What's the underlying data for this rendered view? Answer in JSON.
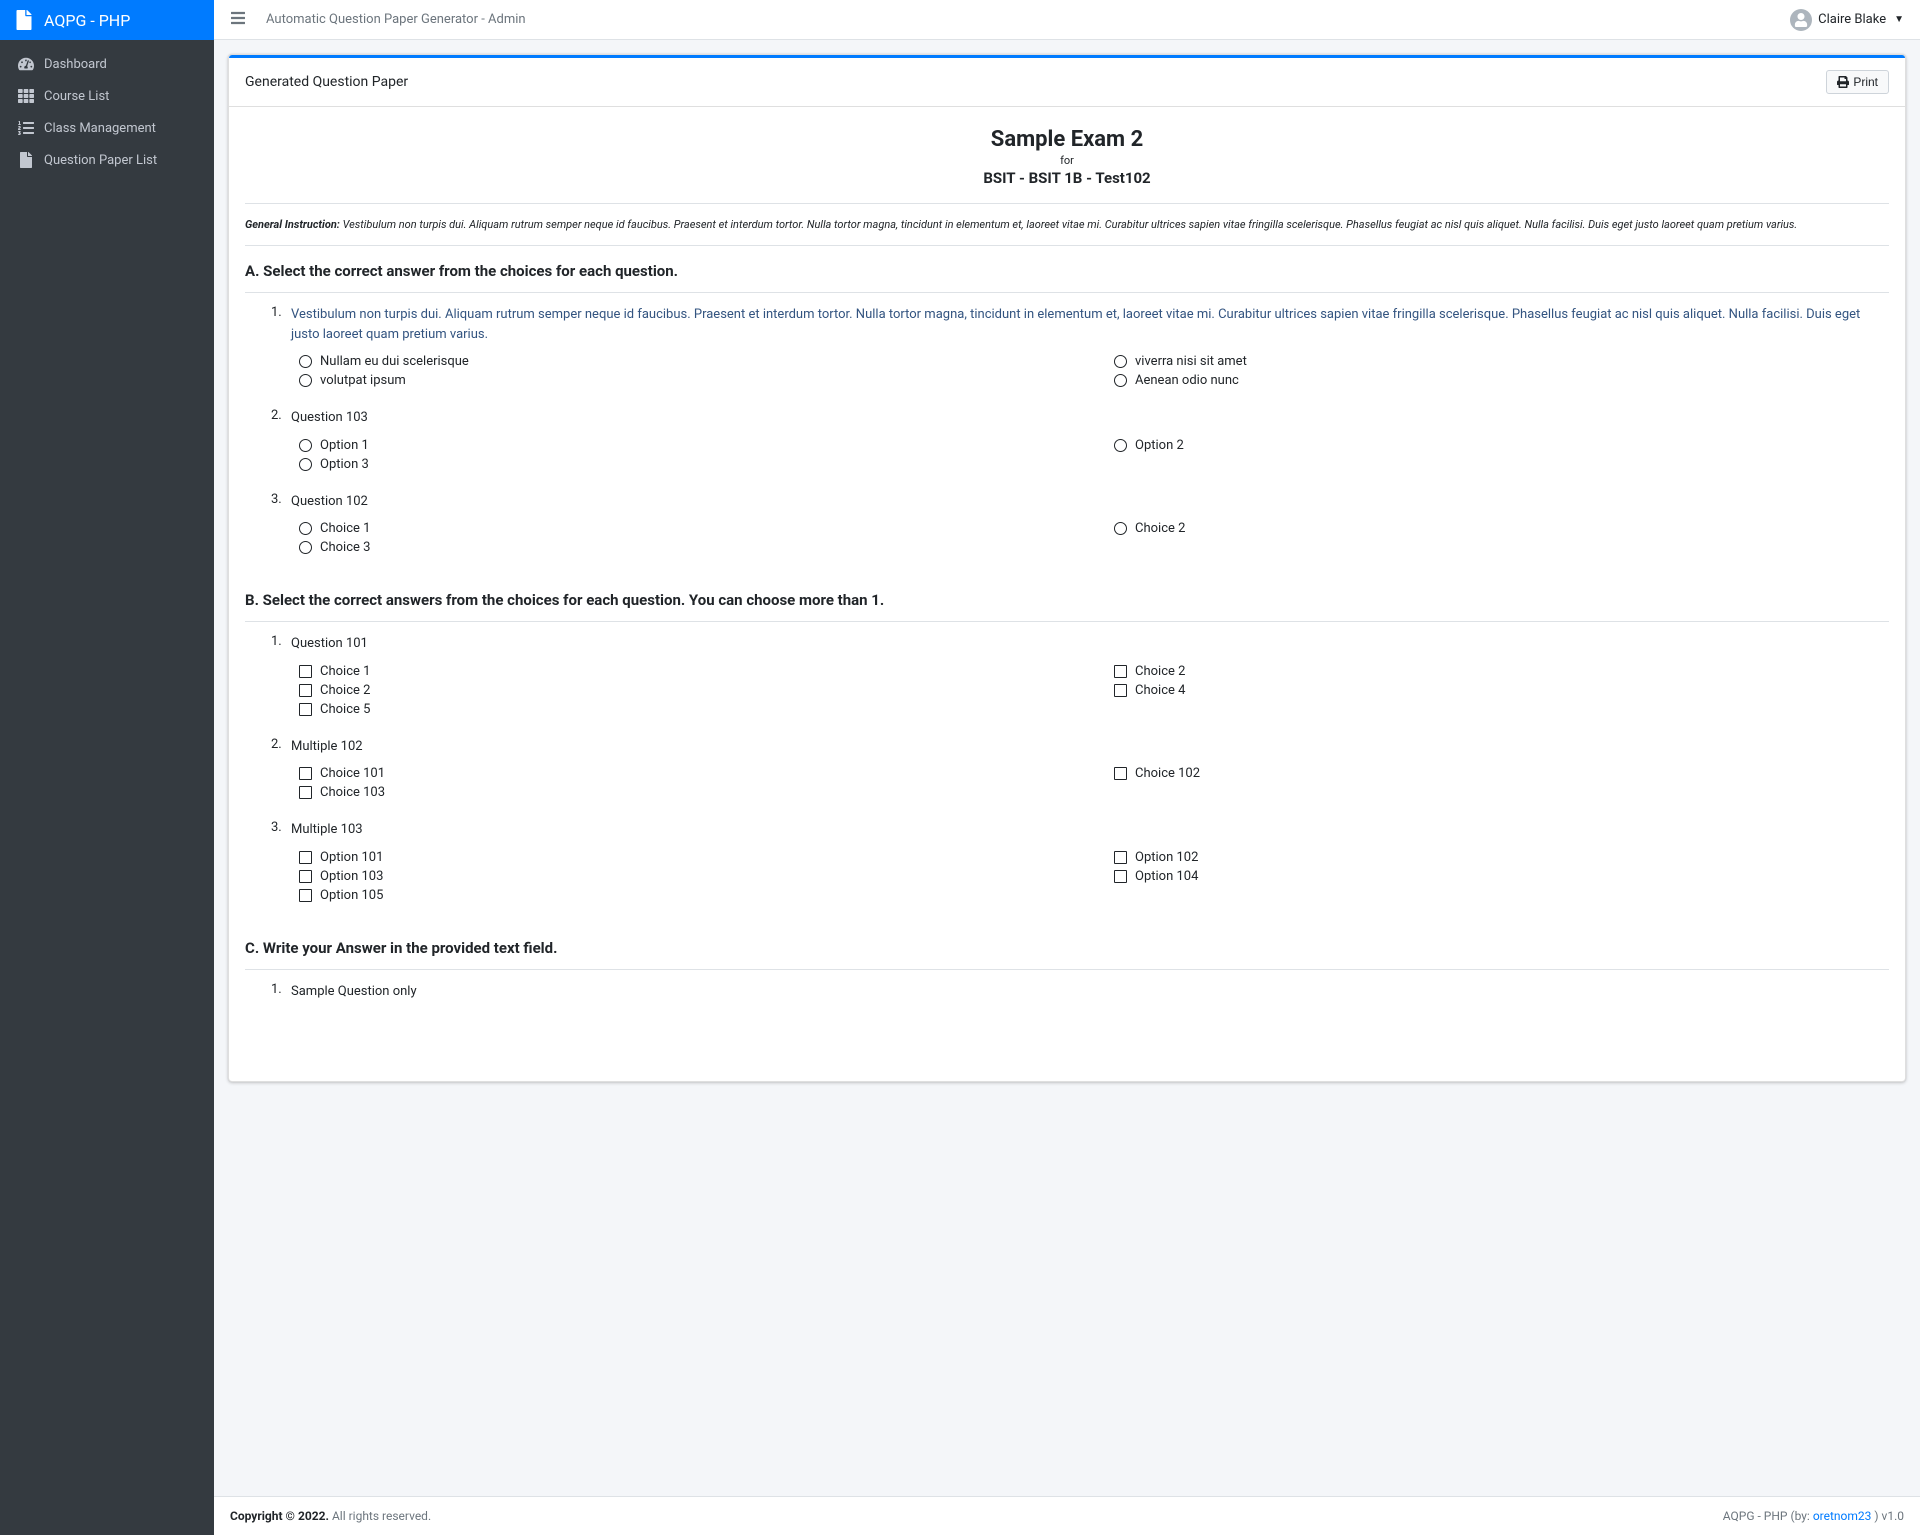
{
  "brand": "AQPG - PHP",
  "navbar": {
    "title": "Automatic Question Paper Generator - Admin",
    "user": "Claire Blake"
  },
  "sidebar": {
    "items": [
      {
        "label": "Dashboard",
        "icon": "dashboard"
      },
      {
        "label": "Course List",
        "icon": "th-list"
      },
      {
        "label": "Class Management",
        "icon": "list-ol"
      },
      {
        "label": "Question Paper List",
        "icon": "file"
      }
    ]
  },
  "card": {
    "title": "Generated Question Paper",
    "print_label": "Print"
  },
  "exam": {
    "title": "Sample Exam 2",
    "for_label": "for",
    "class": "BSIT - BSIT 1B - Test102",
    "instruction_label": "General Instruction:",
    "instruction_text": "Vestibulum non turpis dui. Aliquam rutrum semper neque id faucibus. Praesent et interdum tortor. Nulla tortor magna, tincidunt in elementum et, laoreet vitae mi. Curabitur ultrices sapien vitae fringilla scelerisque. Phasellus feugiat ac nisl quis aliquet. Nulla facilisi. Duis eget justo laoreet quam pretium varius."
  },
  "sections": [
    {
      "title": "A. Select the correct answer from the choices for each question.",
      "type": "radio",
      "questions": [
        {
          "num": "1.",
          "text": "Vestibulum non turpis dui. Aliquam rutrum semper neque id faucibus. Praesent et interdum tortor. Nulla tortor magna, tincidunt in elementum et, laoreet vitae mi. Curabitur ultrices sapien vitae fringilla scelerisque. Phasellus feugiat ac nisl quis aliquet. Nulla facilisi. Duis eget justo laoreet quam pretium varius.",
          "highlight": true,
          "choices": [
            "Nullam eu dui scelerisque",
            "viverra nisi sit amet",
            "volutpat ipsum",
            "Aenean odio nunc"
          ]
        },
        {
          "num": "2.",
          "text": "Question 103",
          "choices": [
            "Option 1",
            "Option 2",
            "Option 3"
          ]
        },
        {
          "num": "3.",
          "text": "Question 102",
          "choices": [
            "Choice 1",
            "Choice 2",
            "Choice 3"
          ]
        }
      ]
    },
    {
      "title": "B. Select the correct answers from the choices for each question. You can choose more than 1.",
      "type": "checkbox",
      "questions": [
        {
          "num": "1.",
          "text": "Question 101",
          "choices": [
            "Choice 1",
            "Choice 2",
            "Choice 2",
            "Choice 4",
            "Choice 5"
          ]
        },
        {
          "num": "2.",
          "text": "Multiple 102",
          "choices": [
            "Choice 101",
            "Choice 102",
            "Choice 103"
          ]
        },
        {
          "num": "3.",
          "text": "Multiple 103",
          "choices": [
            "Option 101",
            "Option 102",
            "Option 103",
            "Option 104",
            "Option 105"
          ]
        }
      ]
    },
    {
      "title": "C. Write your Answer in the provided text field.",
      "type": "text",
      "questions": [
        {
          "num": "1.",
          "text": "Sample Question only"
        }
      ]
    }
  ],
  "footer": {
    "copyright_bold": "Copyright © 2022.",
    "copyright_rest": " All rights reserved.",
    "app": "AQPG - PHP (by: ",
    "author": "oretnom23",
    "version_suffix": " ) v1.0"
  }
}
